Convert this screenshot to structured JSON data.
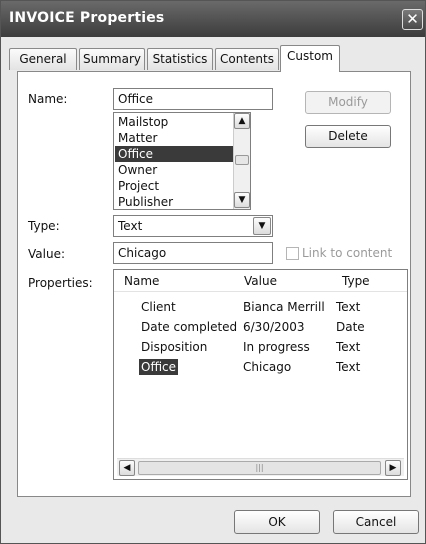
{
  "window": {
    "title": "INVOICE Properties",
    "close_glyph": "✕"
  },
  "tabs": [
    {
      "label": "General"
    },
    {
      "label": "Summary"
    },
    {
      "label": "Statistics"
    },
    {
      "label": "Contents"
    },
    {
      "label": "Custom",
      "active": true
    }
  ],
  "custom": {
    "name_label": "Name:",
    "name_value": "Office",
    "name_list": [
      "Mailstop",
      "Matter",
      "Office",
      "Owner",
      "Project",
      "Publisher"
    ],
    "selected_name": "Office",
    "modify_label": "Modify",
    "delete_label": "Delete",
    "type_label": "Type:",
    "type_value": "Text",
    "value_label": "Value:",
    "value_value": "Chicago",
    "link_label": "Link to content",
    "properties_label": "Properties:",
    "properties": {
      "columns": [
        "Name",
        "Value",
        "Type"
      ],
      "rows": [
        {
          "name": "Client",
          "value": "Bianca Merrill",
          "type": "Text"
        },
        {
          "name": "Date completed",
          "value": "6/30/2003",
          "type": "Date"
        },
        {
          "name": "Disposition",
          "value": "In progress",
          "type": "Text"
        },
        {
          "name": "Office",
          "value": "Chicago",
          "type": "Text",
          "selected": true
        }
      ]
    }
  },
  "footer": {
    "ok_label": "OK",
    "cancel_label": "Cancel"
  },
  "icons": {
    "scroll_up": "▲",
    "scroll_down": "▼",
    "dropdown": "▼",
    "scroll_left": "◀",
    "scroll_right": "▶",
    "grip": "|||"
  }
}
